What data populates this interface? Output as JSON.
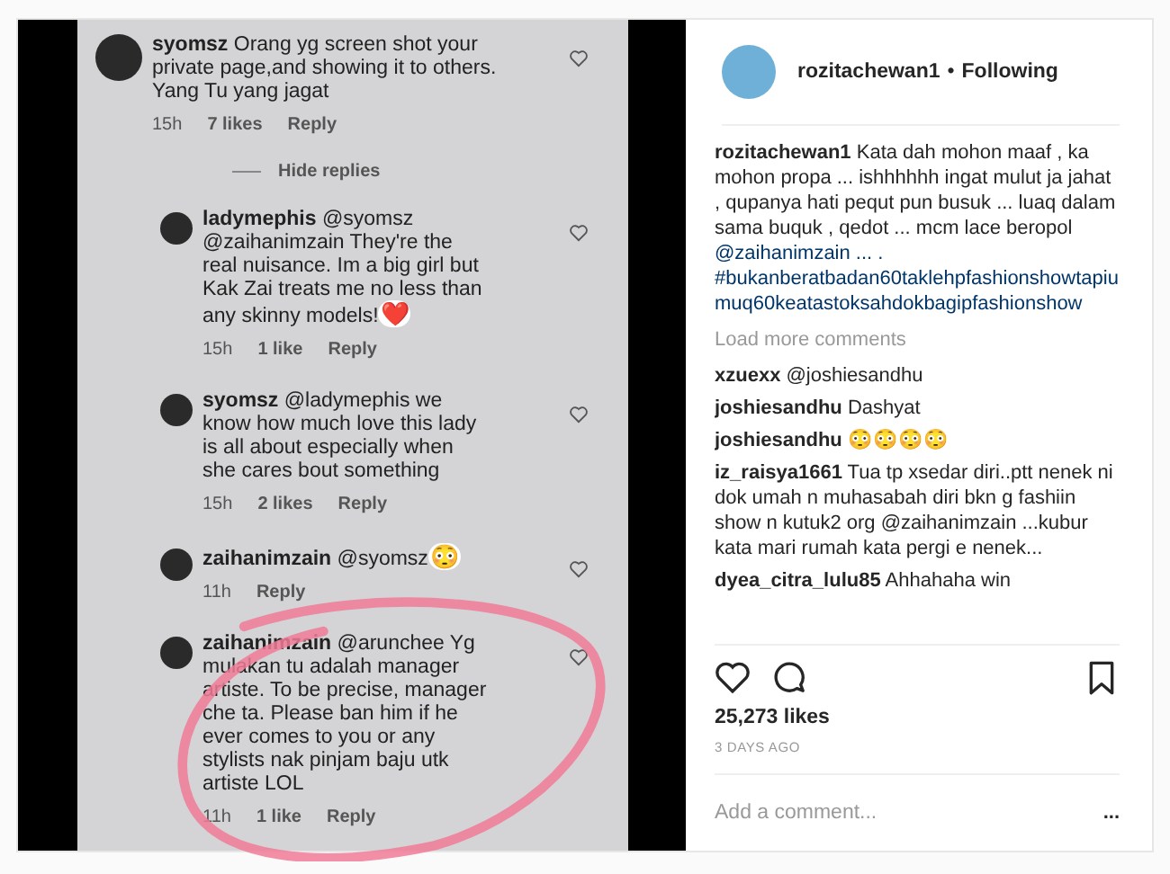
{
  "photo": {
    "comments": [
      {
        "kind": "comment",
        "user": "syomsz",
        "text": "Orang yg screen shot your private page,and showing it to others. Yang Tu yang jagat",
        "time": "15h",
        "likes": "7 likes",
        "reply": "Reply"
      },
      {
        "kind": "divider",
        "label": "Hide replies"
      },
      {
        "kind": "reply",
        "user": "ladymephis",
        "text": "@syomsz @zaihanimzain They're the real nuisance. Im a big girl but Kak Zai treats me no less than any skinny models!",
        "emoji": "❤️",
        "time": "15h",
        "likes": "1 like",
        "reply": "Reply"
      },
      {
        "kind": "reply",
        "user": "syomsz",
        "text": "@ladymephis we know how much love this lady is all about especially when she cares bout something",
        "time": "15h",
        "likes": "2 likes",
        "reply": "Reply"
      },
      {
        "kind": "reply",
        "user": "zaihanimzain",
        "text": "@syomsz",
        "emoji": "😳",
        "time": "11h",
        "reply": "Reply"
      },
      {
        "kind": "reply",
        "user": "zaihanimzain",
        "text": "@arunchee Yg mulakan tu adalah manager artiste. To be precise, manager che ta. Please ban him if he ever comes to you or any stylists nak pinjam baju utk artiste LOL",
        "time": "11h",
        "likes": "1 like",
        "reply": "Reply"
      }
    ]
  },
  "post": {
    "user": "rozitachewan1",
    "dot": "•",
    "follow": "Following",
    "caption": {
      "user": "rozitachewan1",
      "text": "Kata dah mohon maaf , ka mohon propa ... ishhhhhh ingat mulut ja jahat , qupanya hati pequt pun busuk ... luaq dalam sama buquk , qedot ... mcm lace beropol",
      "mention": "@zaihanimzain ... .",
      "hashtag": "#bukanberatbadan60taklehpfashionshowtapiumuq60keatastoksahdokbagipfashionshow"
    },
    "load_more": "Load more comments",
    "comments": [
      {
        "user": "xzuexx",
        "text": "@joshiesandhu"
      },
      {
        "user": "joshiesandhu",
        "text": "Dashyat"
      },
      {
        "user": "joshiesandhu",
        "text": "😳😳😳😳"
      },
      {
        "user": "iz_raisya1661",
        "text": "Tua tp xsedar diri..ptt nenek ni dok umah n muhasabah diri bkn g fashiin show n kutuk2 org @zaihanimzain ...kubur kata mari rumah kata pergi e nenek..."
      },
      {
        "user": "dyea_citra_lulu85",
        "text": "Ahhahaha win"
      }
    ],
    "likes": "25,273 likes",
    "date": "3 DAYS AGO",
    "add_comment": {
      "placeholder": "Add a comment..."
    },
    "more": "..."
  }
}
